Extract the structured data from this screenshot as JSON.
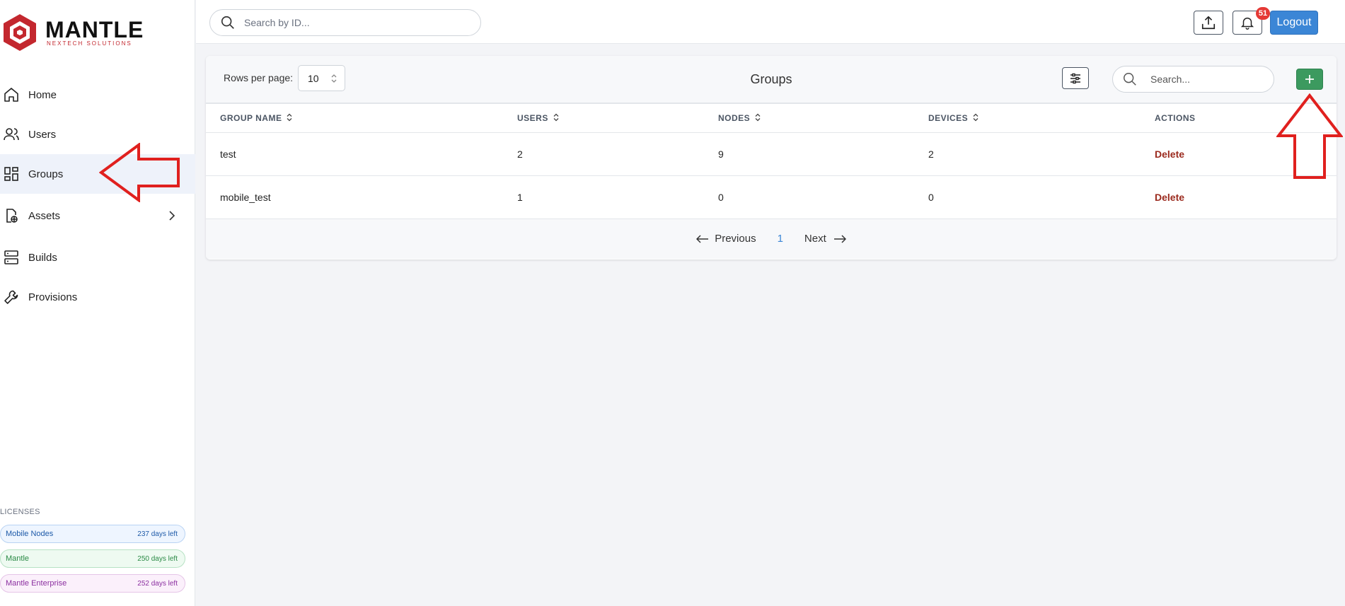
{
  "brand": {
    "name": "MANTLE",
    "tagline": "NEXTECH SOLUTIONS"
  },
  "sidebar": {
    "items": [
      {
        "label": "Home",
        "icon": "home-icon",
        "active": false
      },
      {
        "label": "Users",
        "icon": "users-icon",
        "active": false
      },
      {
        "label": "Groups",
        "icon": "groups-icon",
        "active": true
      },
      {
        "label": "Assets",
        "icon": "assets-icon",
        "active": false,
        "has_submenu": true
      },
      {
        "label": "Builds",
        "icon": "builds-icon",
        "active": false
      },
      {
        "label": "Provisions",
        "icon": "wrench-icon",
        "active": false
      }
    ],
    "licenses_title": "LICENSES",
    "licenses": [
      {
        "name": "Mobile Nodes",
        "days": "237 days left",
        "color": "#1e5aa8"
      },
      {
        "name": "Mantle",
        "days": "250 days left",
        "color": "#2b8a46"
      },
      {
        "name": "Mantle Enterprise",
        "days": "252 days left",
        "color": "#8b2fa0"
      }
    ]
  },
  "topbar": {
    "search_placeholder": "Search by ID...",
    "notification_count": "51",
    "logout_label": "Logout"
  },
  "groups_panel": {
    "rows_per_page_label": "Rows per page:",
    "rows_per_page_value": "10",
    "title": "Groups",
    "search_placeholder": "Search...",
    "columns": [
      "GROUP NAME",
      "USERS",
      "NODES",
      "DEVICES",
      "ACTIONS"
    ],
    "rows": [
      {
        "name": "test",
        "users": "2",
        "nodes": "9",
        "devices": "2",
        "action": "Delete"
      },
      {
        "name": "mobile_test",
        "users": "1",
        "nodes": "0",
        "devices": "0",
        "action": "Delete"
      }
    ],
    "pagination": {
      "previous": "Previous",
      "page": "1",
      "next": "Next"
    }
  },
  "colors": {
    "primary": "#3b86d6",
    "add_button": "#3c9a5f",
    "delete": "#9b2a1e",
    "badge": "#e53935",
    "annotation": "#e0201e",
    "brand_red": "#c3272e"
  }
}
